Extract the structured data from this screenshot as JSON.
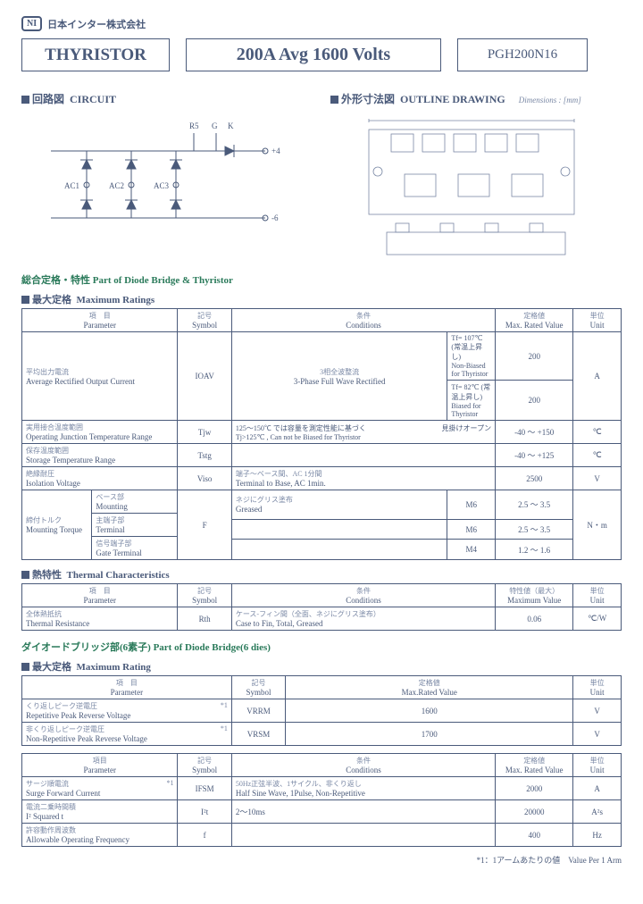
{
  "company": {
    "logo": "NI",
    "name": "日本インター株式会社"
  },
  "header": {
    "box1": "THYRISTOR",
    "box2": "200A Avg  1600 Volts",
    "box3": "PGH200N16"
  },
  "sections": {
    "circuit_jp": "回路図",
    "circuit_en": "CIRCUIT",
    "outline_jp": "外形寸法図",
    "outline_en": "OUTLINE DRAWING",
    "dims_note": "Dimensions : [mm]",
    "part_title": "総合定格・特性  Part of Diode Bridge & Thyristor",
    "max_ratings_jp": "最大定格",
    "max_ratings_en": "Maximum Ratings",
    "thermal_jp": "熱特性",
    "thermal_en": "Thermal Characteristics",
    "diode_title": "ダイオードブリッジ部(6素子)  Part of Diode Bridge(6 dies)",
    "max_rating_jp": "最大定格",
    "max_rating_en": "Maximum Rating"
  },
  "circuit_labels": {
    "r5": "R5",
    "g": "G",
    "k": "K",
    "p4": "○+4",
    "n6": "○-6",
    "ac1": "AC1○",
    "ac2": "AC2○",
    "ac3": "AC3○"
  },
  "table1": {
    "headers": {
      "param_jp": "項　目",
      "param_en": "Parameter",
      "sym_jp": "記号",
      "sym_en": "Symbol",
      "cond_jp": "条件",
      "cond_en": "Conditions",
      "max_jp": "定格値",
      "max_en": "Max. Rated Value",
      "unit_jp": "単位",
      "unit_en": "Unit"
    },
    "r1": {
      "param_jp": "平均出力電流",
      "param_en": "Average Rectified Output Current",
      "sym": "IOAV",
      "cond_main_jp": "3相全波整流",
      "cond_main_en": "3-Phase Full Wave Rectified",
      "cond_a": "Tf= 107℃ (常温上昇し)",
      "cond_a2": "Non-Biased for Thyristor",
      "val_a": "200",
      "cond_b": "Tf=  82℃ (常温上昇し)",
      "cond_b2": "Biased for Thyristor",
      "val_b": "200",
      "unit": "A"
    },
    "r2": {
      "param_jp": "実用接合温度範囲",
      "param_en": "Operating Junction Temperature Range",
      "sym": "Tjw",
      "cond_a": "125～150℃ では容量を測定性能に基づく",
      "cond_a2": "見掛けオープン",
      "cond_b": "Tj>125℃ , Can not be Biased for Thyristor",
      "val": "-40 ～ +150",
      "unit": "℃"
    },
    "r3": {
      "param_jp": "保存温度範囲",
      "param_en": "Storage Temperature Range",
      "sym": "Tstg",
      "val": "-40 ～ +125",
      "unit": "℃"
    },
    "r4": {
      "param_jp": "絶縁耐圧",
      "param_en": "Isolation Voltage",
      "sym": "Viso",
      "cond_jp": "端子～ベース間、AC 1分間",
      "cond_en": "Terminal to Base, AC 1min.",
      "val": "2500",
      "unit": "V"
    },
    "r5": {
      "param_jp": "締付トルク",
      "param_en": "Mounting Torque",
      "sym": "F",
      "sub1_jp": "ベース部",
      "sub1_en": "Mounting",
      "sub2_jp": "主端子部",
      "sub2_en": "Terminal",
      "sub3_jp": "信号端子部",
      "sub3_en": "Gate Terminal",
      "cond1_jp": "ネジにグリス塗布",
      "cond1_en": "Greased",
      "m6": "M6",
      "v1": "2.5 ～ 3.5",
      "m6b": "M6",
      "v2": "2.5 ～ 3.5",
      "m4": "M4",
      "v3": "1.2 ～ 1.6",
      "unit": "N・m"
    }
  },
  "table2": {
    "headers": {
      "param_jp": "項　目",
      "param_en": "Parameter",
      "sym_jp": "記号",
      "sym_en": "Symbol",
      "cond_jp": "条件",
      "cond_en": "Conditions",
      "max_jp": "特性値（最大）",
      "max_en": "Maximum Value",
      "unit_jp": "単位",
      "unit_en": "Unit"
    },
    "r1": {
      "param_jp": "全体熱抵抗",
      "param_en": "Thermal Resistance",
      "sym": "Rth",
      "cond_jp": "ケース-フィン間（全面、ネジにグリス塗布）",
      "cond_en": "Case to Fin, Total, Greased",
      "val": "0.06",
      "unit": "℃/W"
    }
  },
  "table3a": {
    "headers": {
      "param_jp": "項　目",
      "param_en": "Parameter",
      "sym_jp": "記号",
      "sym_en": "Symbol",
      "max_jp": "定格値",
      "max_en": "Max.Rated Value",
      "unit_jp": "単位",
      "unit_en": "Unit"
    },
    "r1": {
      "param_jp": "くり返しピーク逆電圧",
      "star": "*1",
      "param_en": "Repetitive Peak Reverse Voltage",
      "sym": "VRRM",
      "val": "1600",
      "unit": "V"
    },
    "r2": {
      "param_jp": "非くり返しピーク逆電圧",
      "star": "*1",
      "param_en": "Non-Repetitive Peak Reverse Voltage",
      "sym": "VRSM",
      "val": "1700",
      "unit": "V"
    }
  },
  "table3b": {
    "headers": {
      "param_jp": "項目",
      "param_en": "Parameter",
      "sym_jp": "記号",
      "sym_en": "Symbol",
      "cond_jp": "条件",
      "cond_en": "Conditions",
      "max_jp": "定格値",
      "max_en": "Max. Rated Value",
      "unit_jp": "単位",
      "unit_en": "Unit"
    },
    "r1": {
      "param_jp": "サージ順電流",
      "star": "*1",
      "param_en": "Surge Forward Current",
      "sym": "IFSM",
      "cond_jp": "50Hz正弦半波、1サイクル、非くり返し",
      "cond_en": "Half Sine Wave, 1Pulse, Non-Repetitive",
      "val": "2000",
      "unit": "A"
    },
    "r2": {
      "param_jp": "電流二乗時間積",
      "param_en": "I² Squared t",
      "sym": "I²t",
      "cond": "2～10ms",
      "val": "20000",
      "unit": "A²s"
    },
    "r3": {
      "param_jp": "許容動作周波数",
      "param_en": "Allowable Operating Frequency",
      "sym": "f",
      "val": "400",
      "unit": "Hz"
    }
  },
  "footnote": "*1：1アームあたりの値　Value Per 1 Arm"
}
